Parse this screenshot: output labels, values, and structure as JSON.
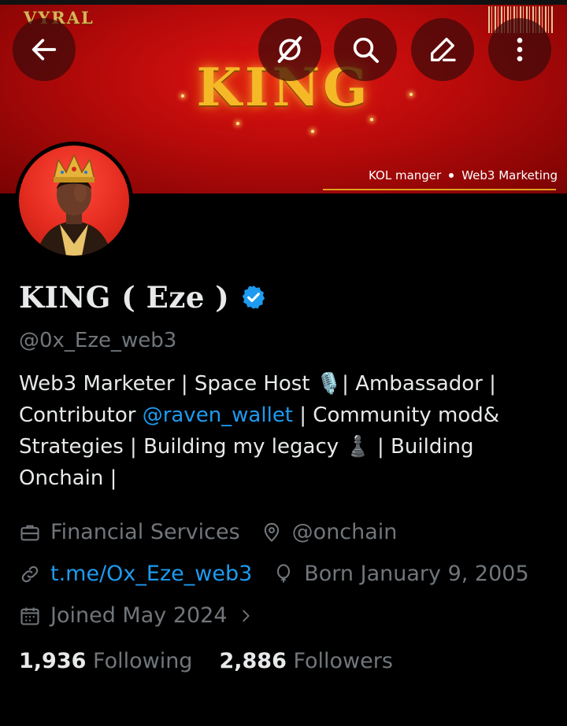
{
  "header": {
    "brand": "VYRAL",
    "banner_title": "KING",
    "tagline_left": "KOL manger",
    "tagline_right": "Web3 Marketing"
  },
  "toolbar": {
    "back_icon": "arrow-left-icon",
    "grok_icon": "grok-icon",
    "search_icon": "search-icon",
    "edit_icon": "pencil-icon",
    "more_icon": "more-vertical-icon"
  },
  "profile": {
    "display_name": "KING ( Eze )",
    "handle": "@0x_Eze_web3",
    "verified": true,
    "bio": {
      "line1": "Web3 Marketer | Space Host 🎙️| Ambassador |",
      "line2_prefix": "Contributor ",
      "line2_mention": "@raven_wallet",
      "line2_suffix": " | Community mod&",
      "line3": "Strategies | Building my legacy ♟️ | Building",
      "line4": "Onchain |"
    }
  },
  "meta": {
    "category": "Financial Services",
    "location": "@onchain",
    "website": "t.me/Ox_Eze_web3",
    "birthday": "Born January 9, 2005",
    "joined": "Joined May 2024"
  },
  "stats": {
    "following_count": "1,936",
    "following_label": "Following",
    "followers_count": "2,886",
    "followers_label": "Followers"
  },
  "colors": {
    "link": "#1d9bf0",
    "muted": "#71767b",
    "text": "#e7e9ea",
    "banner_red": "#d11010",
    "gold": "#f5b927"
  }
}
